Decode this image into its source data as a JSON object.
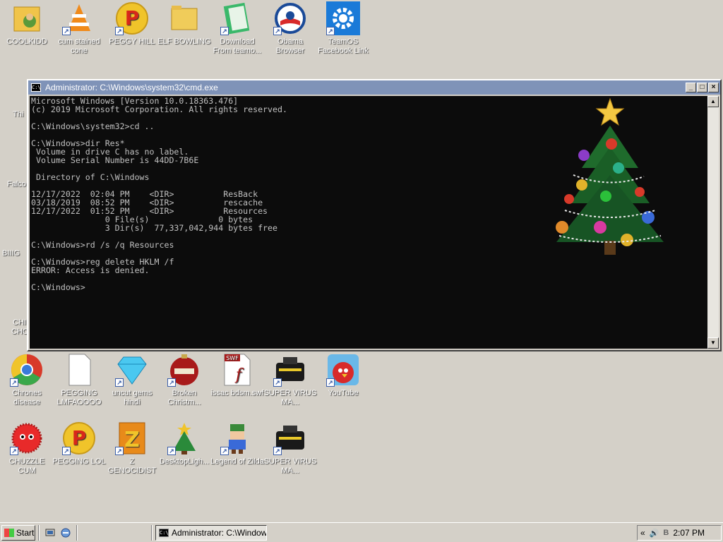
{
  "desktop": {
    "icons": [
      {
        "label": "COOLKIDD",
        "icon": "folder-user-icon"
      },
      {
        "label": "cum stained cone",
        "icon": "vlc-cone-icon"
      },
      {
        "label": "PEGGY HILL",
        "icon": "p-logo-icon"
      },
      {
        "label": "ELF BOWLING",
        "icon": "folder-icon"
      },
      {
        "label": "Download From teamo...",
        "icon": "green-notebook-icon"
      },
      {
        "label": "Obama Browser",
        "icon": "obama-logo-icon"
      },
      {
        "label": "TeamOS Facebook Link",
        "icon": "gear-icon"
      },
      {
        "label": "Chrones disease",
        "icon": "chrome-icon"
      },
      {
        "label": "PEGGING LMFAOOOO",
        "icon": "blank-file-icon"
      },
      {
        "label": "uncut gems hindi",
        "icon": "diamond-icon"
      },
      {
        "label": "Broken Christm...",
        "icon": "christmas-ornament-icon"
      },
      {
        "label": "issac bdsm.swf",
        "icon": "flash-swf-icon"
      },
      {
        "label": "SUPER VIRUS MA...",
        "icon": "camera-bag-icon"
      },
      {
        "label": "YouTube",
        "icon": "angry-bird-icon"
      },
      {
        "label": "CHUZZLE CUM",
        "icon": "red-fuzzy-icon"
      },
      {
        "label": "PEGGING LOL",
        "icon": "p-logo-icon"
      },
      {
        "label": "Z GENOCIDIST",
        "icon": "z-block-icon"
      },
      {
        "label": "DesktopLigh...",
        "icon": "christmas-tree-icon"
      },
      {
        "label": "Legend of Zilda",
        "icon": "pixel-character-icon"
      },
      {
        "label": "SUPER VIRUS MA...",
        "icon": "camera-bag-icon"
      }
    ],
    "partial_labels": [
      "Thi",
      "Falco",
      "BIIIG",
      "CHI",
      "CHC"
    ],
    "shortcut_glyph": "↗"
  },
  "cmd": {
    "title": "Administrator: C:\\Windows\\system32\\cmd.exe",
    "title_icon": "C:\\",
    "minimize": "_",
    "maximize": "□",
    "close": "×",
    "scroll_up": "▲",
    "scroll_down": "▼",
    "lines": [
      "Microsoft Windows [Version 10.0.18363.476]",
      "(c) 2019 Microsoft Corporation. All rights reserved.",
      "",
      "C:\\Windows\\system32>cd ..",
      "",
      "C:\\Windows>dir Res*",
      " Volume in drive C has no label.",
      " Volume Serial Number is 44DD-7B6E",
      "",
      " Directory of C:\\Windows",
      "",
      "12/17/2022  02:04 PM    <DIR>          ResBack",
      "03/18/2019  08:52 PM    <DIR>          rescache",
      "12/17/2022  01:52 PM    <DIR>          Resources",
      "               0 File(s)              0 bytes",
      "               3 Dir(s)  77,337,042,944 bytes free",
      "",
      "C:\\Windows>rd /s /q Resources",
      "",
      "C:\\Windows>reg delete HKLM /f",
      "ERROR: Access is denied.",
      "",
      "C:\\Windows>"
    ]
  },
  "taskbar": {
    "start_label": "Start",
    "quicklaunch": [
      {
        "icon": "show-desktop-icon"
      },
      {
        "icon": "ie-icon"
      }
    ],
    "task_button_label": "Administrator: C:\\Window...",
    "tray_chevron": "«",
    "volume_icon": "🔊",
    "clock": "2:07 PM"
  }
}
